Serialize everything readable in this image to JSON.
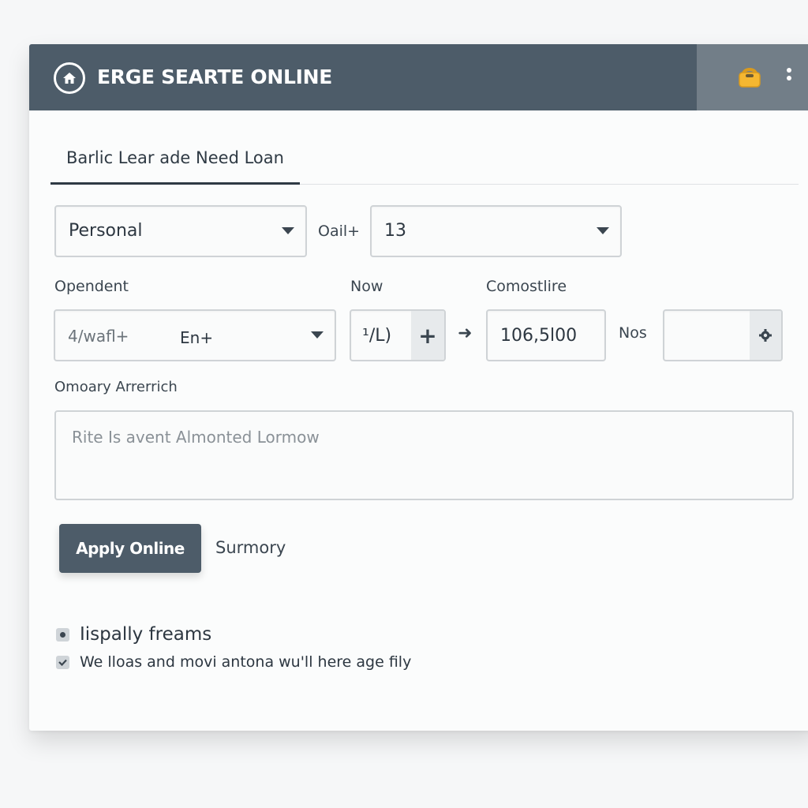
{
  "header": {
    "title": "ERGE SEARTE ONLINE",
    "icons": [
      "home-icon",
      "lock-icon",
      "more-vertical-icon"
    ]
  },
  "tab": {
    "label": "Barlic Lear ade Need Loan"
  },
  "row1": {
    "loan_type": {
      "value": "Personal"
    },
    "mid_label": "Oail+",
    "term": {
      "value": "13"
    }
  },
  "row2": {
    "labels": {
      "opendent": "Opendent",
      "now": "Now",
      "comostlire": "Comostlire",
      "nos": "Nos"
    },
    "opendent_select": {
      "value": "4/wafl+",
      "suffix": "En+"
    },
    "now_stepper": {
      "value": "¹/L)",
      "plus": "+"
    },
    "arrow": "➜",
    "comostlire_input": {
      "value": "106,5l00"
    },
    "nos_input": {
      "value": ""
    }
  },
  "notes": {
    "label": "Omoary Arrerrich",
    "placeholder": "Rite Is avent Almonted Lormow"
  },
  "actions": {
    "apply_label": "Apply Online",
    "summary_label": "Surmory"
  },
  "options": [
    {
      "label": "Iispally freams",
      "checked": false
    },
    {
      "label": "We lloas and movi antona wu'll here age fily",
      "checked": true
    }
  ],
  "colors": {
    "header_bg": "#4d5c69",
    "header_right_bg": "#727e88",
    "lock": "#f5b731",
    "button_bg": "#4d5c69"
  }
}
